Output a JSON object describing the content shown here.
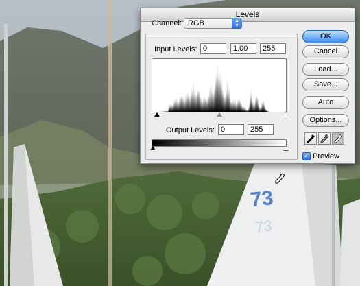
{
  "dialog": {
    "title": "Levels",
    "channel_label": "Channel:",
    "channel_value": "RGB",
    "input_levels_label": "Input Levels:",
    "input_black": "0",
    "input_gamma": "1.00",
    "input_white": "255",
    "output_levels_label": "Output Levels:",
    "output_black": "0",
    "output_white": "255",
    "buttons": {
      "ok": "OK",
      "cancel": "Cancel",
      "load": "Load...",
      "save": "Save...",
      "auto": "Auto",
      "options": "Options..."
    },
    "preview_label": "Preview",
    "preview_checked": true
  },
  "photo": {
    "sail_number": "73"
  },
  "colors": {
    "accent": "#3a8ee8"
  }
}
